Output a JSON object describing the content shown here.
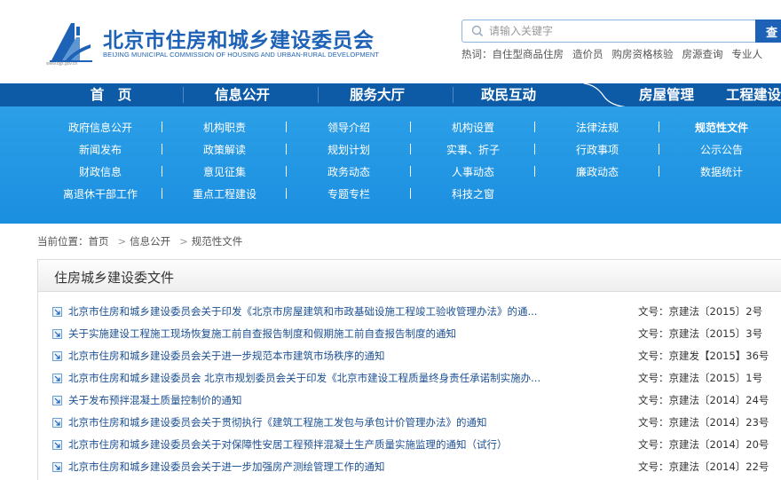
{
  "header": {
    "title": "北京市住房和城乡建设委员会",
    "subtitle": "BEIJING MUNICIPAL COMMISSION OF HOUSING AND URBAN-RURAL DEVELOPMENT",
    "logo_url": "www.bjjs.gov.cn"
  },
  "search": {
    "placeholder": "请输入关键字",
    "button_label": "查",
    "hot_label": "热词：",
    "hot_words": [
      "自住型商品住房",
      "造价员",
      "购房资格核验",
      "房源查询",
      "专业人"
    ]
  },
  "nav": {
    "items": [
      "首　页",
      "信息公开",
      "服务大厅",
      "政民互动",
      "房屋管理",
      "工程建设"
    ]
  },
  "subnav": {
    "rows": [
      [
        "政府信息公开",
        "机构职责",
        "领导介绍",
        "机构设置",
        "法律法规",
        "规范性文件"
      ],
      [
        "新闻发布",
        "政策解读",
        "规划计划",
        "实事、折子",
        "行政事项",
        "公示公告"
      ],
      [
        "财政信息",
        "意见征集",
        "政务动态",
        "人事动态",
        "廉政动态",
        "数据统计"
      ],
      [
        "离退休干部工作",
        "重点工程建设",
        "专题专栏",
        "科技之窗"
      ]
    ]
  },
  "breadcrumb": {
    "label": "当前位置：",
    "items": [
      "首页",
      "信息公开",
      "规范性文件"
    ]
  },
  "panel": {
    "title": "住房城乡建设委文件",
    "documents": [
      {
        "title": "北京市住房和城乡建设委员会关于印发《北京市房屋建筑和市政基础设施工程竣工验收管理办法》的通...",
        "number": "文号：京建法〔2015〕2号"
      },
      {
        "title": "关于实施建设工程施工现场恢复施工前自查报告制度和假期施工前自查报告制度的通知",
        "number": "文号：京建法〔2015〕3号"
      },
      {
        "title": "北京市住房和城乡建设委员会关于进一步规范本市建筑市场秩序的通知",
        "number": "文号：京建发【2015】36号"
      },
      {
        "title": "北京市住房和城乡建设委员会 北京市规划委员会关于印发《北京市建设工程质量终身责任承诺制实施办...",
        "number": "文号：京建法〔2015〕1号"
      },
      {
        "title": "关于发布预拌混凝土质量控制价的通知",
        "number": "文号：京建法〔2014〕24号"
      },
      {
        "title": "北京市住房和城乡建设委员会关于贯彻执行《建筑工程施工发包与承包计价管理办法》的通知",
        "number": "文号：京建法〔2014〕23号"
      },
      {
        "title": "北京市住房和城乡建设委员会关于对保障性安居工程预拌混凝土生产质量实施监理的通知（试行）",
        "number": "文号：京建法〔2014〕20号"
      },
      {
        "title": "北京市住房和城乡建设委员会关于进一步加强房产测绘管理工作的通知",
        "number": "文号：京建法〔2014〕22号"
      }
    ]
  },
  "colors": {
    "brand_blue": "#1d62b7",
    "nav_blue": "#0d5aa7",
    "subnav_blue": "#2c9fe8",
    "link_blue": "#1b4f91"
  }
}
